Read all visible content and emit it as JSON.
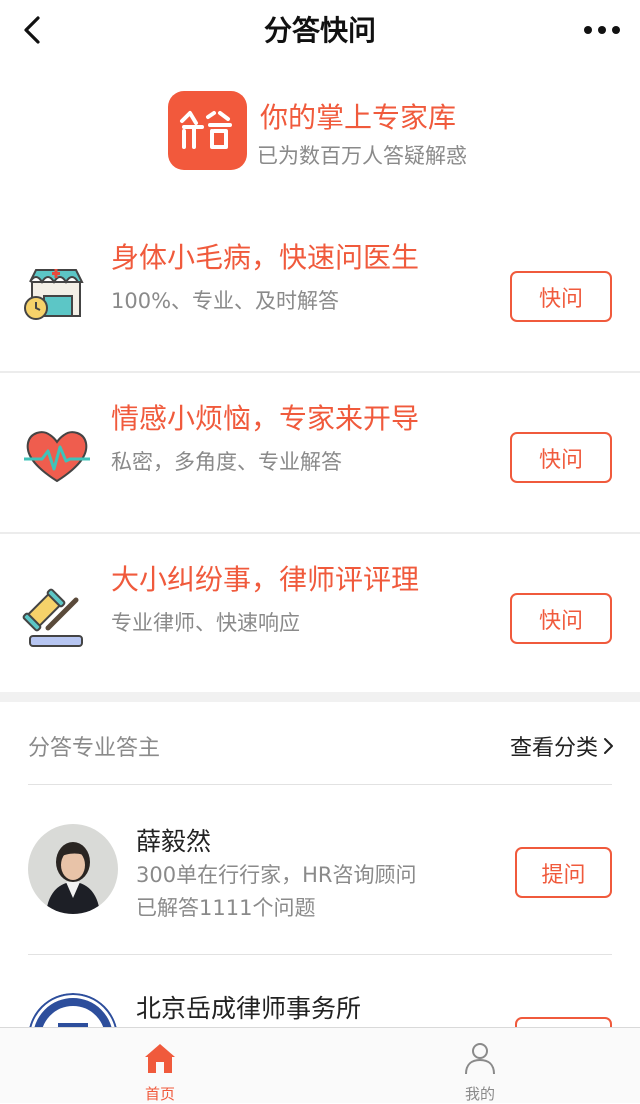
{
  "nav": {
    "title": "分答快问"
  },
  "brand": {
    "title": "你的掌上专家库",
    "subtitle": "已为数百万人答疑解惑",
    "accent_color": "#f05a3c"
  },
  "services": [
    {
      "icon": "clinic-icon",
      "title": "身体小毛病，快速问医生",
      "desc": "100%、专业、及时解答",
      "button": "快问"
    },
    {
      "icon": "heartbeat-icon",
      "title": "情感小烦恼，专家来开导",
      "desc": "私密，多角度、专业解答",
      "button": "快问"
    },
    {
      "icon": "gavel-icon",
      "title": "大小纠纷事，律师评评理",
      "desc": "专业律师、快速响应",
      "button": "快问"
    }
  ],
  "experts_section": {
    "title": "分答专业答主",
    "link": "查看分类"
  },
  "experts": [
    {
      "name": "薛毅然",
      "bio": "300单在行行家，HR咨询顾问",
      "stats": "已解答1111个问题",
      "button": "提问"
    },
    {
      "name": "北京岳成律师事务所",
      "bio": "",
      "stats": "",
      "button": ""
    }
  ],
  "tabbar": {
    "items": [
      {
        "label": "首页",
        "icon": "home-icon",
        "active": true
      },
      {
        "label": "我的",
        "icon": "user-icon",
        "active": false
      }
    ],
    "active_color": "#f05a3c",
    "inactive_color": "#8a8a8a"
  }
}
